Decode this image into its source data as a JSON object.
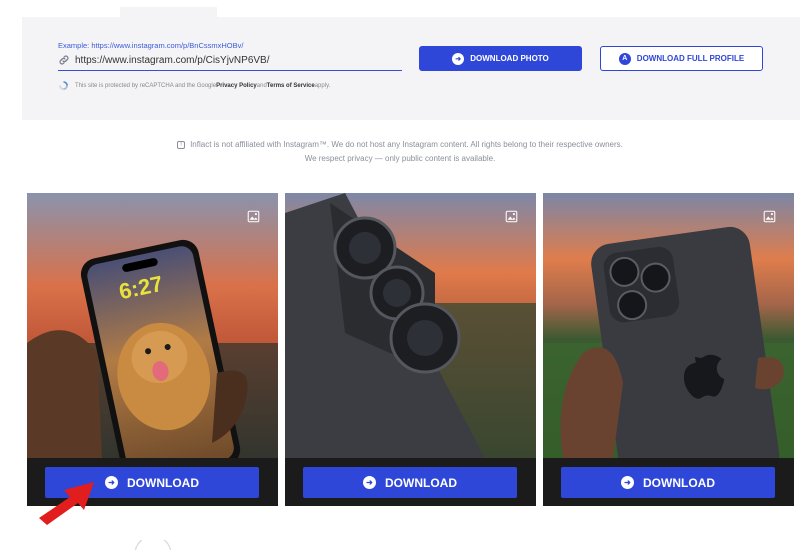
{
  "search": {
    "example": "Example: https://www.instagram.com/p/BnCssmxHOBv/",
    "url_value": "https://www.instagram.com/p/CisYjvNP6VB/",
    "download_photo_label": "DOWNLOAD PHOTO",
    "download_profile_label": "DOWNLOAD FULL PROFILE",
    "download_photo_icon": "arrow-right-circle-icon",
    "download_profile_icon": "a-circle-icon",
    "recaptcha_prefix": "This site is protected by reCAPTCHA and the Google ",
    "privacy_label": "Privacy Policy",
    "and_label": " and ",
    "terms_label": "Terms of Service",
    "apply_label": " apply."
  },
  "notice": {
    "line1": "Inflact is not affiliated with Instagram™. We do not host any Instagram content. All rights belong to their respective owners.",
    "line2": "We respect privacy — only public content is available."
  },
  "cards": [
    {
      "download_label": "DOWNLOAD",
      "screen_time": "6:27"
    },
    {
      "download_label": "DOWNLOAD"
    },
    {
      "download_label": "DOWNLOAD"
    }
  ],
  "colors": {
    "accent": "#2f47d9",
    "panel": "#f4f4f6",
    "arrow": "#e11d1d"
  }
}
